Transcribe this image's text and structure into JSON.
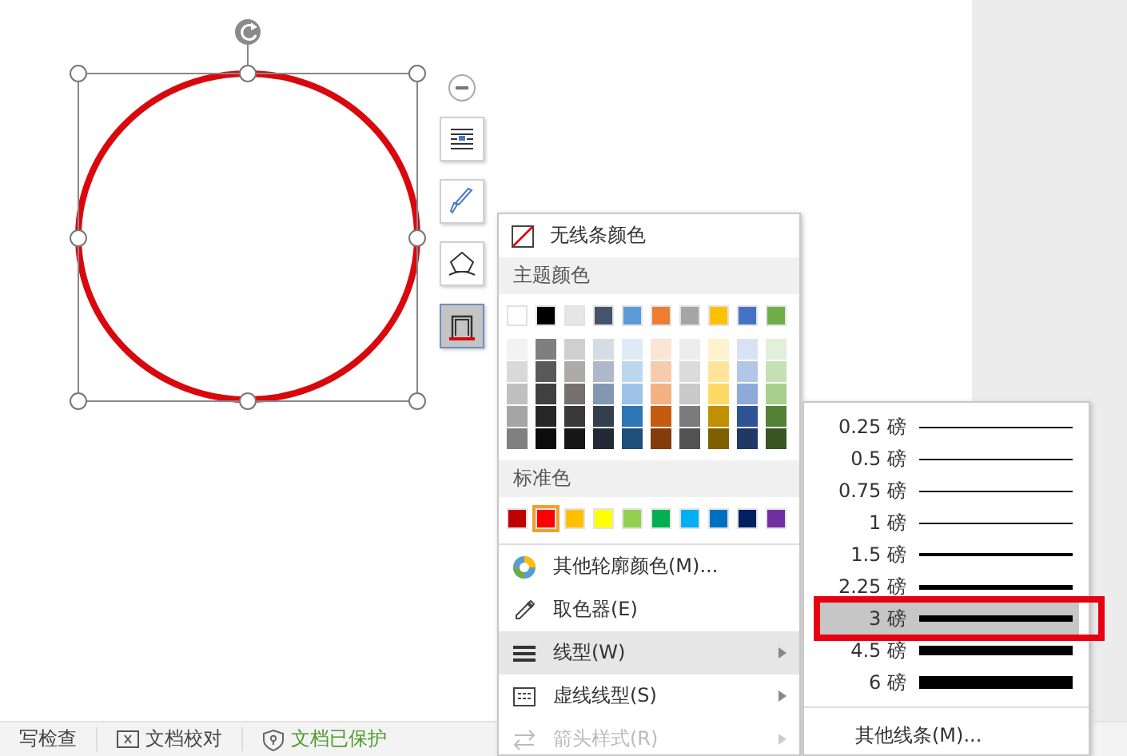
{
  "shapes": [
    {
      "kind": "circle",
      "selected": true,
      "color": "#d9080d"
    }
  ],
  "side_toolbar": [
    {
      "kind": "layout",
      "selected": false
    },
    {
      "kind": "fill",
      "selected": false
    },
    {
      "kind": "effect",
      "selected": false
    },
    {
      "kind": "outline",
      "selected": true
    }
  ],
  "outline_menu": {
    "no_line": "无线条颜色",
    "theme_header": "主题颜色",
    "theme_top": [
      {
        "color": "#ffffff"
      },
      {
        "color": "#000000"
      },
      {
        "color": "#e7e6e6"
      },
      {
        "color": "#44546a"
      },
      {
        "color": "#5b9bd5"
      },
      {
        "color": "#ed7d31"
      },
      {
        "color": "#a5a5a5"
      },
      {
        "color": "#ffc000"
      },
      {
        "color": "#4472c4"
      },
      {
        "color": "#70ad47"
      }
    ],
    "theme_shades": [
      {
        "swatches": [
          {
            "color": "#f2f2f2"
          },
          {
            "color": "#7f7f7f"
          },
          {
            "color": "#d0cece"
          },
          {
            "color": "#d6dce4"
          },
          {
            "color": "#deebf6"
          },
          {
            "color": "#fbe5d5"
          },
          {
            "color": "#ededed"
          },
          {
            "color": "#fff2cc"
          },
          {
            "color": "#d9e2f3"
          },
          {
            "color": "#e2efd9"
          }
        ]
      },
      {
        "swatches": [
          {
            "color": "#d9d9d9"
          },
          {
            "color": "#595959"
          },
          {
            "color": "#aeaaaa"
          },
          {
            "color": "#adb9ca"
          },
          {
            "color": "#bdd7ee"
          },
          {
            "color": "#f8cbad"
          },
          {
            "color": "#dbdbdb"
          },
          {
            "color": "#fee599"
          },
          {
            "color": "#b4c6e7"
          },
          {
            "color": "#c5e0b3"
          }
        ]
      },
      {
        "swatches": [
          {
            "color": "#bfbfbf"
          },
          {
            "color": "#404040"
          },
          {
            "color": "#757171"
          },
          {
            "color": "#8497b0"
          },
          {
            "color": "#9dc3e6"
          },
          {
            "color": "#f4b183"
          },
          {
            "color": "#c9c9c9"
          },
          {
            "color": "#ffd965"
          },
          {
            "color": "#8eaadb"
          },
          {
            "color": "#a8d08d"
          }
        ]
      },
      {
        "swatches": [
          {
            "color": "#a6a6a6"
          },
          {
            "color": "#262626"
          },
          {
            "color": "#3a3838"
          },
          {
            "color": "#333f4f"
          },
          {
            "color": "#2e75b5"
          },
          {
            "color": "#c55a11"
          },
          {
            "color": "#7b7b7b"
          },
          {
            "color": "#bf9000"
          },
          {
            "color": "#2f5496"
          },
          {
            "color": "#538135"
          }
        ]
      },
      {
        "swatches": [
          {
            "color": "#808080"
          },
          {
            "color": "#0d0d0d"
          },
          {
            "color": "#171616"
          },
          {
            "color": "#222a35"
          },
          {
            "color": "#1f4e79"
          },
          {
            "color": "#833c0b"
          },
          {
            "color": "#525252"
          },
          {
            "color": "#7f6000"
          },
          {
            "color": "#1f3864"
          },
          {
            "color": "#375623"
          }
        ]
      }
    ],
    "standard_header": "标准色",
    "standard": [
      {
        "color": "#c00000",
        "selected": false
      },
      {
        "color": "#ff0000",
        "selected": true
      },
      {
        "color": "#ffc000",
        "selected": false
      },
      {
        "color": "#ffff00",
        "selected": false
      },
      {
        "color": "#92d050",
        "selected": false
      },
      {
        "color": "#00b050",
        "selected": false
      },
      {
        "color": "#00b0f0",
        "selected": false
      },
      {
        "color": "#0070c0",
        "selected": false
      },
      {
        "color": "#002060",
        "selected": false
      },
      {
        "color": "#7030a0",
        "selected": false
      }
    ],
    "items": [
      {
        "kind": "more_colors",
        "label": "其他轮廓颜色(M)...",
        "selected": false,
        "disabled": false,
        "submenu": false
      },
      {
        "kind": "eyedropper",
        "label": "取色器(E)",
        "selected": false,
        "disabled": false,
        "submenu": false
      },
      {
        "kind": "weight",
        "label": "线型(W)",
        "selected": true,
        "disabled": false,
        "submenu": true
      },
      {
        "kind": "dash",
        "label": "虚线线型(S)",
        "selected": false,
        "disabled": false,
        "submenu": true
      },
      {
        "kind": "arrow",
        "label": "箭头样式(R)",
        "selected": false,
        "disabled": true,
        "submenu": true
      }
    ]
  },
  "weight_menu": {
    "items": [
      {
        "label": "0.25 磅",
        "selected": false,
        "annotated": false
      },
      {
        "label": "0.5 磅",
        "selected": false,
        "annotated": false
      },
      {
        "label": "0.75 磅",
        "selected": false,
        "annotated": false
      },
      {
        "label": "1 磅",
        "selected": false,
        "annotated": false
      },
      {
        "label": "1.5 磅",
        "selected": false,
        "annotated": false
      },
      {
        "label": "2.25 磅",
        "selected": false,
        "annotated": false
      },
      {
        "label": "3 磅",
        "selected": true,
        "annotated": true
      },
      {
        "label": "4.5 磅",
        "selected": false,
        "annotated": false
      },
      {
        "label": "6 磅",
        "selected": false,
        "annotated": false
      }
    ],
    "more": "其他线条(M)..."
  },
  "status_bar": [
    {
      "kind": "spell",
      "label": "写检查"
    },
    {
      "kind": "proofread",
      "label": "文档校对"
    },
    {
      "kind": "protected",
      "label": "文档已保护"
    }
  ]
}
